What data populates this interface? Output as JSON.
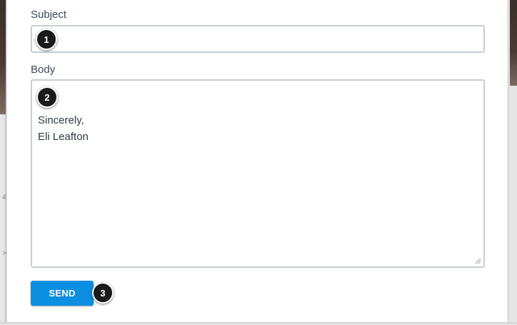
{
  "form": {
    "subject_label": "Subject",
    "subject_value": "",
    "subject_placeholder": "",
    "body_label": "Body",
    "body_lines": [
      "Sincerely,",
      "Eli Leafton"
    ],
    "send_label": "SEND"
  },
  "callouts": [
    "1",
    "2",
    "3"
  ],
  "edge_marks": [
    "4",
    ">"
  ],
  "colors": {
    "send_button": "#0c8fe0",
    "callout_fill": "#1a1a1a",
    "label_text": "#3d4a57",
    "input_border": "#c7cdd1"
  },
  "icons": {
    "resize_handle": "resize-grip-icon"
  }
}
